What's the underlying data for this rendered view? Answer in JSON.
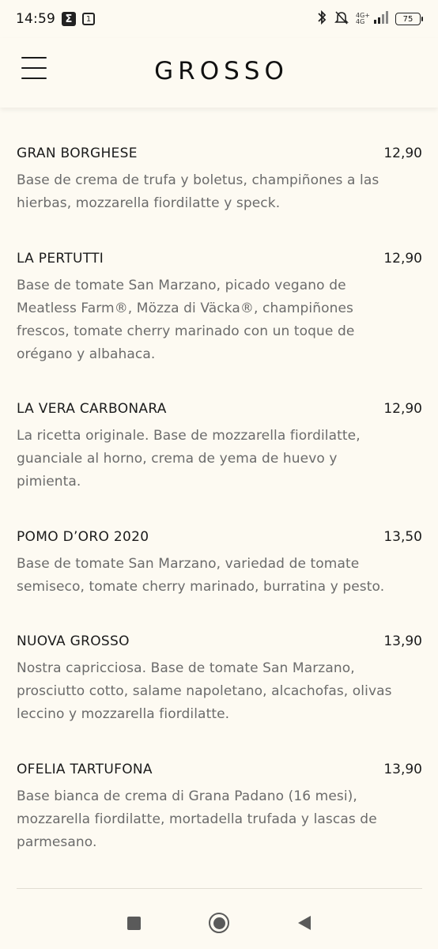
{
  "status_bar": {
    "time": "14:59",
    "notif_icons": [
      "sigma-icon",
      "calendar-icon"
    ],
    "calendar_day": "1",
    "network": "4G+",
    "network_sub": "4G",
    "battery": "75"
  },
  "header": {
    "brand": "GROSSO",
    "menu_icon": "hamburger-menu-icon"
  },
  "menu": {
    "items": [
      {
        "name": "GRAN BORGHESE",
        "price": "12,90",
        "description": "Base de crema de trufa y boletus, champiñones a las hierbas, mozzarella fiordilatte y speck."
      },
      {
        "name": "LA PERTUTTI",
        "price": "12,90",
        "description": "Base de tomate San Marzano, picado vegano de Meatless Farm®, Mözza di Väcka®, champiñones frescos, tomate cherry marinado con un toque de orégano y albahaca."
      },
      {
        "name": "LA VERA CARBONARA",
        "price": "12,90",
        "description": "La ricetta originale. Base de mozzarella fiordilatte, guanciale al horno, crema de yema de huevo y pimienta."
      },
      {
        "name": "POMO D’ORO 2020",
        "price": "13,50",
        "description": "Base de tomate San Marzano, variedad de tomate semiseco, tomate cherry marinado, burratina y pesto."
      },
      {
        "name": "NUOVA GROSSO",
        "price": "13,90",
        "description": "Nostra capricciosa. Base de tomate San Marzano, prosciutto cotto, salame napoletano, alcachofas, olivas leccino y mozzarella fiordilatte."
      },
      {
        "name": "OFELIA TARTUFONA",
        "price": "13,90",
        "description": "Base bianca de crema di Grana Padano (16 mesi), mozzarella fiordilatte, mortadella trufada y lascas de parmesano."
      }
    ]
  },
  "nav_bar": {
    "buttons": [
      "recents-button",
      "home-button",
      "back-button"
    ]
  },
  "colors": {
    "background": "#fdfaf2",
    "text_primary": "#1b1b1b",
    "text_secondary": "#6b6b6b"
  }
}
